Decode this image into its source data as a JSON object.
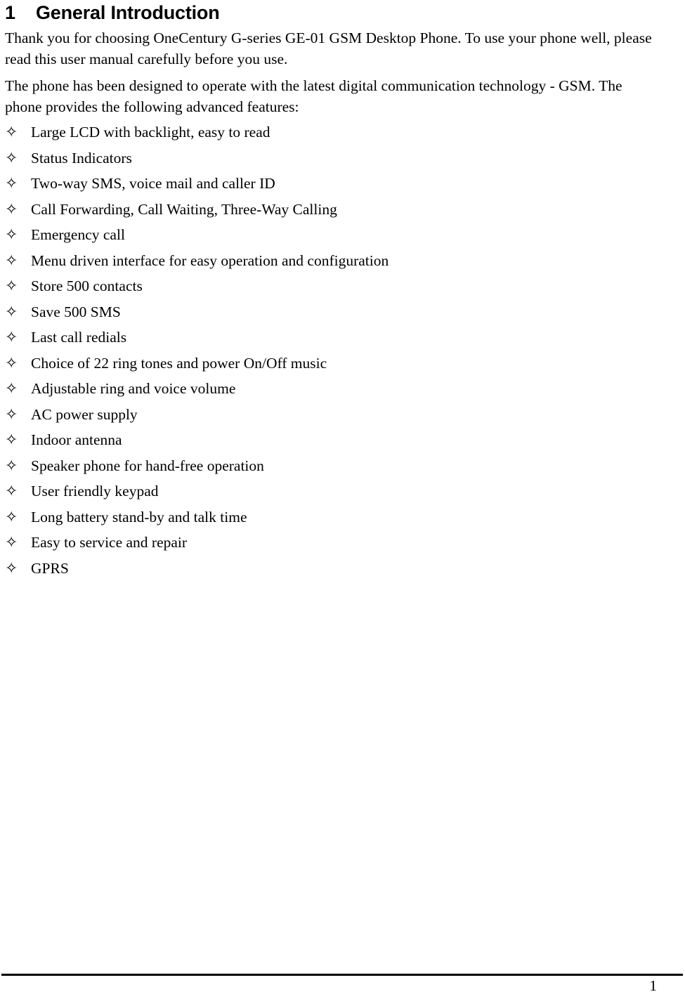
{
  "document": {
    "heading": {
      "number": "1",
      "title": "General Introduction"
    },
    "paragraphs": [
      "Thank you for choosing OneCentury G-series GE-01 GSM Desktop Phone. To use your phone well, please read this user manual carefully before you use.",
      "The phone has been designed to operate with the latest digital communication technology - GSM. The phone provides the following advanced features:"
    ],
    "bullet_glyph": "✧",
    "features": [
      "Large LCD with backlight, easy to read",
      "Status Indicators",
      "Two-way SMS, voice mail and caller ID",
      "Call Forwarding, Call Waiting, Three-Way Calling",
      "Emergency call",
      "Menu driven interface for easy operation and configuration",
      "Store 500 contacts",
      "Save 500 SMS",
      "Last call redials",
      "Choice of 22 ring tones and power On/Off music",
      "Adjustable ring and voice volume",
      "AC power supply",
      "Indoor antenna",
      "Speaker phone for hand-free operation",
      "User friendly keypad",
      "Long battery stand-by and talk time",
      "Easy to service and repair",
      "GPRS"
    ],
    "footer": {
      "page_number": "1"
    }
  }
}
